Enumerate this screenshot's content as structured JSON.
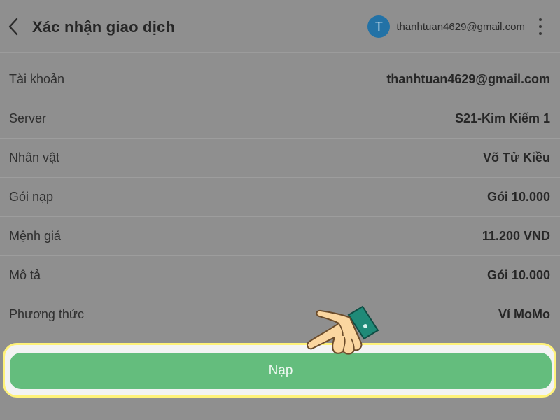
{
  "header": {
    "title": "Xác nhận giao dịch",
    "avatar_letter": "T",
    "account_email": "thanhtuan4629@gmail.com"
  },
  "details": [
    {
      "label": "Tài khoản",
      "value": "thanhtuan4629@gmail.com"
    },
    {
      "label": "Server",
      "value": "S21-Kim Kiếm 1"
    },
    {
      "label": "Nhân vật",
      "value": "Võ Tử Kiều"
    },
    {
      "label": "Gói nạp",
      "value": "Gói 10.000"
    },
    {
      "label": "Mệnh giá",
      "value": "11.200 VND"
    },
    {
      "label": "Mô tả",
      "value": "Gói 10.000"
    },
    {
      "label": "Phương thức",
      "value": "Ví MoMo"
    }
  ],
  "submit": {
    "label": "Nạp"
  },
  "colors": {
    "overlay_background": "#8f8f8f",
    "avatar": "#2372a6",
    "submit_button": "#64bd7d",
    "highlight_border": "#fff27a"
  },
  "icons": {
    "back": "chevron-left-icon",
    "more": "vertical-dots-icon",
    "pointer": "pointing-hand-icon"
  }
}
